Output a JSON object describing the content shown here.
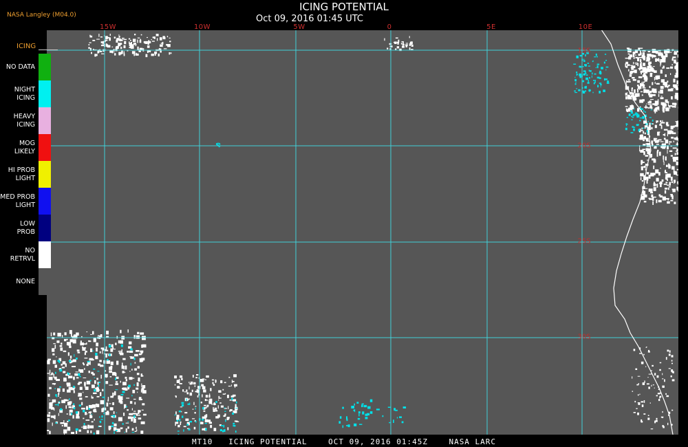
{
  "header": {
    "title": "ICING POTENTIAL",
    "subtitle": "Oct 09, 2016 01:45 UTC",
    "credit": "NASA Langley (M04.0)"
  },
  "map": {
    "longitude_labels": [
      "15W",
      "10W",
      "5W",
      "0",
      "5E",
      "10E"
    ],
    "latitude_labels": [
      "15S",
      "20S",
      "25S",
      "30S"
    ],
    "colors": {
      "background": "#565656",
      "grid": "#40d0d8",
      "coastline": "#ffffff",
      "labels": "#d03030"
    }
  },
  "legend": {
    "title": "ICING",
    "items": [
      {
        "label": "NO DATA",
        "color": "#10b010"
      },
      {
        "label": "NIGHT\nICING",
        "color": "#00f0f0"
      },
      {
        "label": "HEAVY\nICING",
        "color": "#e8b0e0"
      },
      {
        "label": "MOG\nLIKELY",
        "color": "#f01010"
      },
      {
        "label": "HI PROB\nLIGHT",
        "color": "#f0f000"
      },
      {
        "label": "MED PROB\nLIGHT",
        "color": "#1010f0"
      },
      {
        "label": "LOW\nPROB",
        "color": "#000080"
      },
      {
        "label": "NO\nRETRVL",
        "color": "#ffffff"
      },
      {
        "label": "NONE",
        "color": "#565656"
      }
    ]
  },
  "footer": {
    "text": "MT10   ICING POTENTIAL    OCT 09, 2016 01:45Z    NASA LARC"
  }
}
